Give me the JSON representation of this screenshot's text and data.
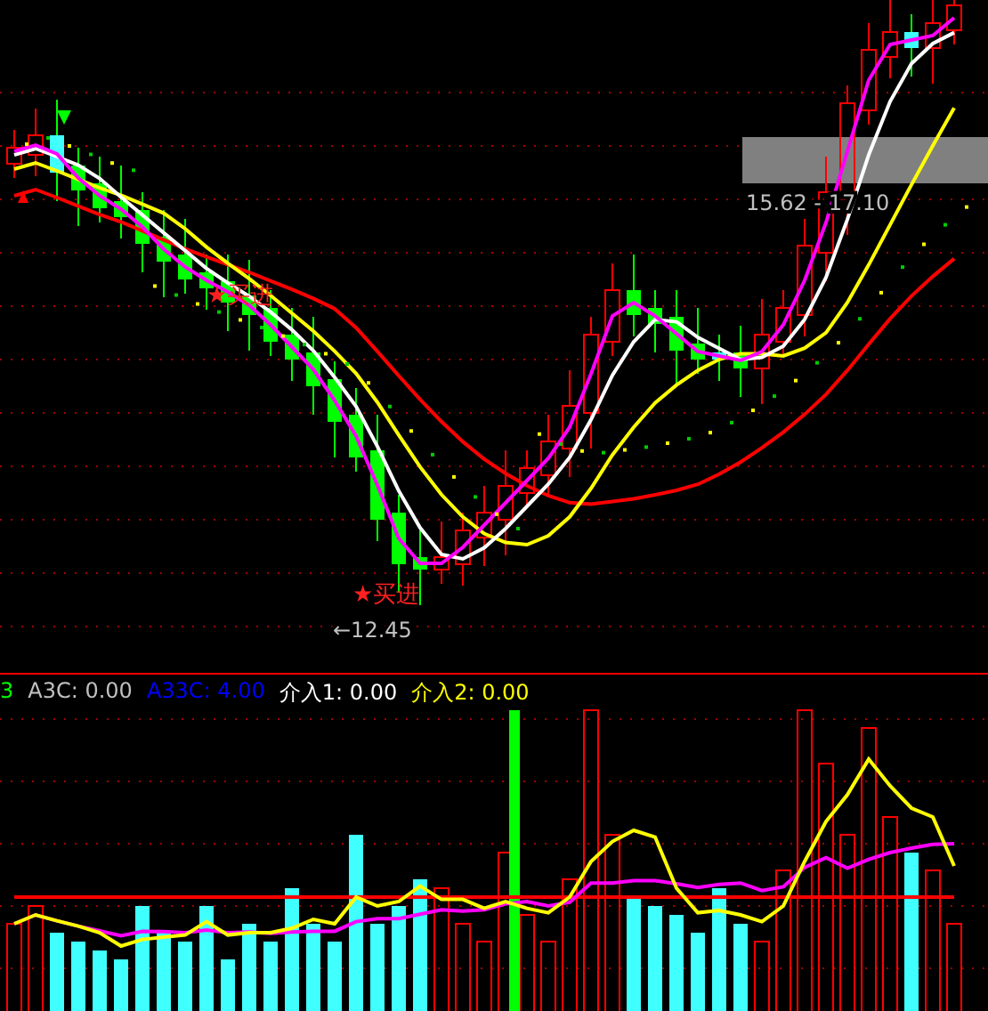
{
  "legend": [
    {
      "label": "3",
      "color": "#00ff00"
    },
    {
      "label": "A3C: 0.00",
      "color": "#c0c0c0"
    },
    {
      "label": "A33C: 4.00",
      "color": "#0000ff"
    },
    {
      "label": "介入1: 0.00",
      "color": "#ffffff"
    },
    {
      "label": "介入2: 0.00",
      "color": "#ffff00"
    }
  ],
  "annotations": [
    {
      "kind": "buy",
      "text": "★买进"
    },
    {
      "kind": "buy",
      "text": "★买进"
    },
    {
      "kind": "low",
      "text": "←12.45"
    },
    {
      "kind": "range",
      "text": "15.62 - 17.10"
    }
  ]
}
